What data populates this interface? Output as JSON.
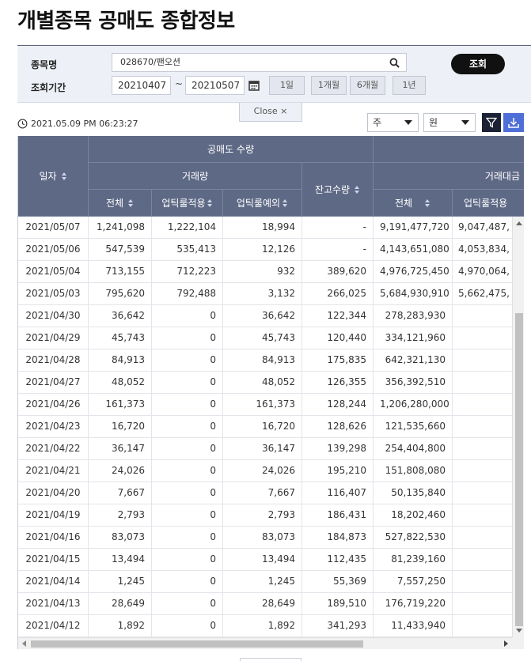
{
  "page": {
    "title": "개별종목 공매도 종합정보"
  },
  "search": {
    "code_label": "종목명",
    "code_value": "028670/팬오션",
    "period_label": "조회기간",
    "date_from": "20210407",
    "date_separator": "~",
    "date_to": "20210507",
    "period_buttons": [
      "1일",
      "1개월",
      "6개월",
      "1년"
    ],
    "query_label": "조회",
    "close_label": "Close ×"
  },
  "toolbar": {
    "timestamp": "2021.05.09 PM 06:23:27",
    "unit_select": "주",
    "currency_select": "원"
  },
  "table": {
    "group1": "공매도 수량",
    "group2": "거래량",
    "col_date": "일자",
    "col_total": "전체",
    "col_applied": "업틱룰적용",
    "col_except": "업틱룰예외",
    "col_balance": "잔고수량",
    "group3": "거래대금",
    "col_amount_total": "전체",
    "col_amount_applied": "업틱룰적용",
    "rows": [
      [
        "2021/05/07",
        "1,241,098",
        "1,222,104",
        "18,994",
        "-",
        "9,191,477,720",
        "9,047,487,"
      ],
      [
        "2021/05/06",
        "547,539",
        "535,413",
        "12,126",
        "-",
        "4,143,651,080",
        "4,053,834,"
      ],
      [
        "2021/05/04",
        "713,155",
        "712,223",
        "932",
        "389,620",
        "4,976,725,450",
        "4,970,064,"
      ],
      [
        "2021/05/03",
        "795,620",
        "792,488",
        "3,132",
        "266,025",
        "5,684,930,910",
        "5,662,475,"
      ],
      [
        "2021/04/30",
        "36,642",
        "0",
        "36,642",
        "122,344",
        "278,283,930",
        ""
      ],
      [
        "2021/04/29",
        "45,743",
        "0",
        "45,743",
        "120,440",
        "334,121,960",
        ""
      ],
      [
        "2021/04/28",
        "84,913",
        "0",
        "84,913",
        "175,835",
        "642,321,130",
        ""
      ],
      [
        "2021/04/27",
        "48,052",
        "0",
        "48,052",
        "126,355",
        "356,392,510",
        ""
      ],
      [
        "2021/04/26",
        "161,373",
        "0",
        "161,373",
        "128,244",
        "1,206,280,000",
        ""
      ],
      [
        "2021/04/23",
        "16,720",
        "0",
        "16,720",
        "128,626",
        "121,535,660",
        ""
      ],
      [
        "2021/04/22",
        "36,147",
        "0",
        "36,147",
        "139,298",
        "254,404,800",
        ""
      ],
      [
        "2021/04/21",
        "24,026",
        "0",
        "24,026",
        "195,210",
        "151,808,080",
        ""
      ],
      [
        "2021/04/20",
        "7,667",
        "0",
        "7,667",
        "116,407",
        "50,135,840",
        ""
      ],
      [
        "2021/04/19",
        "2,793",
        "0",
        "2,793",
        "186,431",
        "18,202,460",
        ""
      ],
      [
        "2021/04/16",
        "83,073",
        "0",
        "83,073",
        "184,873",
        "527,822,530",
        ""
      ],
      [
        "2021/04/15",
        "13,494",
        "0",
        "13,494",
        "112,435",
        "81,239,160",
        ""
      ],
      [
        "2021/04/14",
        "1,245",
        "0",
        "1,245",
        "55,369",
        "7,557,250",
        ""
      ],
      [
        "2021/04/13",
        "28,649",
        "0",
        "28,649",
        "189,510",
        "176,719,220",
        ""
      ],
      [
        "2021/04/12",
        "1,892",
        "0",
        "1,892",
        "341,293",
        "11,433,940",
        ""
      ]
    ]
  },
  "colors": {
    "header_bg": "#5e6986",
    "panel_bg": "#edf0f7",
    "accent": "#4f6fd8",
    "dark_button": "#111111"
  },
  "icons": [
    "search-icon",
    "calendar-icon",
    "clock-icon",
    "filter-icon",
    "download-icon",
    "sort-icon"
  ]
}
